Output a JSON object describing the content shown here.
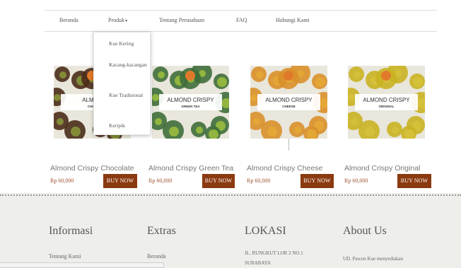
{
  "nav": {
    "items": [
      {
        "label": "Beranda"
      },
      {
        "label": "Produk",
        "caret": "▾"
      },
      {
        "label": "Tentang Perusahaan"
      },
      {
        "label": "FAQ"
      },
      {
        "label": "Hubungi Kami"
      }
    ]
  },
  "dropdown": {
    "items": [
      "Kue Kering",
      "Kacang-kacangan",
      "Kue Tradisional",
      "Keripik"
    ]
  },
  "products": [
    {
      "name": "Almond Crispy Chocolate",
      "price": "Rp 60,000",
      "buy": "BUY NOW",
      "image_label": "ALMON",
      "image_sub": "CHOC",
      "box_color": "#4b2c1a",
      "accent": "#8a9a3a"
    },
    {
      "name": "Almond Crispy Green Tea",
      "price": "Rp 60,000",
      "buy": "BUY NOW",
      "image_label": "ALMOND CRISPY",
      "image_sub": "GREEN TEA",
      "box_color": "#3f6e3a",
      "accent": "#9cbf3c"
    },
    {
      "name": "Almond Crispy Cheese",
      "price": "Rp 60,000",
      "buy": "BUY NOW",
      "image_label": "ALMOND CRISPY",
      "image_sub": "CHEESE",
      "box_color": "#d9902a",
      "accent": "#e5a935"
    },
    {
      "name": "Almond Crispy Original",
      "price": "Rp 60,000",
      "buy": "BUY NOW",
      "image_label": "ALMOND CRISPY",
      "image_sub": "ORIGINAL",
      "box_color": "#c9b222",
      "accent": "#d6c13a"
    }
  ],
  "footer": {
    "informasi": {
      "title": "Informasi",
      "links": [
        "Tentang Kami"
      ]
    },
    "extras": {
      "title": "Extras",
      "links": [
        "Beranda"
      ]
    },
    "lokasi": {
      "title": "LOKASI",
      "lines": [
        "JL. RUNGKUT LOR 2 NO.1",
        "SURABAYA"
      ]
    },
    "about": {
      "title": "About Us",
      "lines": [
        "UD. Pawon Kue menyediakan"
      ]
    }
  },
  "colors": {
    "buy_button": "#8b3a10",
    "price": "#a0522d",
    "footer_bg": "#eeeeea"
  }
}
